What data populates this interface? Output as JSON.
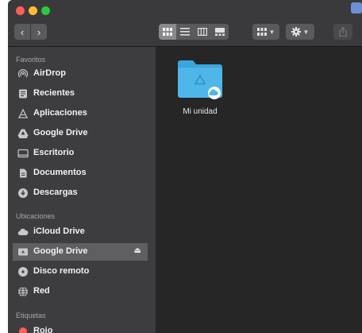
{
  "window": {
    "colors": {
      "accent": "#4fb6ea",
      "close": "#fe5f57",
      "minimize": "#febc2e",
      "zoom": "#28c840"
    }
  },
  "toolbar": {
    "back_label": "‹",
    "forward_label": "›"
  },
  "sidebar": {
    "favorites_header": "Favoritos",
    "favorites": [
      {
        "label": "AirDrop",
        "icon": "airdrop-icon"
      },
      {
        "label": "Recientes",
        "icon": "recents-icon"
      },
      {
        "label": "Aplicaciones",
        "icon": "applications-icon"
      },
      {
        "label": "Google Drive",
        "icon": "google-drive-icon"
      },
      {
        "label": "Escritorio",
        "icon": "desktop-icon"
      },
      {
        "label": "Documentos",
        "icon": "documents-icon"
      },
      {
        "label": "Descargas",
        "icon": "downloads-icon"
      }
    ],
    "locations_header": "Ubicaciones",
    "locations": [
      {
        "label": "iCloud Drive",
        "icon": "cloud-icon"
      },
      {
        "label": "Google Drive",
        "icon": "drive-folder-icon",
        "selected": true
      },
      {
        "label": "Disco remoto",
        "icon": "disc-icon"
      },
      {
        "label": "Red",
        "icon": "network-icon"
      }
    ],
    "tags_header": "Etiquetas",
    "tags": [
      {
        "label": "Rojo",
        "color": "#fe5f57"
      }
    ]
  },
  "content": {
    "items": [
      {
        "label": "Mi unidad",
        "icon": "folder-cloud-icon"
      }
    ]
  }
}
